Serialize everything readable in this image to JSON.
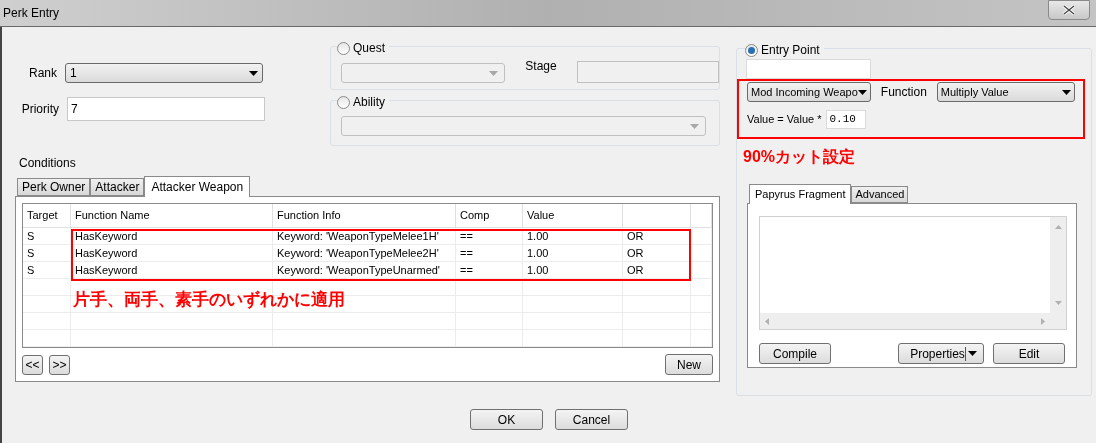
{
  "window": {
    "title": "Perk Entry"
  },
  "rank": {
    "label": "Rank",
    "value": "1"
  },
  "priority": {
    "label": "Priority",
    "value": "7"
  },
  "quest": {
    "label": "Quest",
    "selected": false,
    "stage_label": "Stage"
  },
  "ability": {
    "label": "Ability",
    "selected": false
  },
  "entry_point": {
    "label": "Entry Point",
    "selected": true,
    "entry": "Mod Incoming Weapo",
    "function_label": "Function",
    "function": "Multiply Value",
    "formula_label": "Value = Value *",
    "formula_value": "0.10"
  },
  "conditions": {
    "label": "Conditions",
    "tabs": [
      {
        "label": "Perk Owner",
        "selected": false
      },
      {
        "label": "Attacker",
        "selected": false
      },
      {
        "label": "Attacker Weapon",
        "selected": true
      }
    ],
    "columns": [
      "Target",
      "Function Name",
      "Function Info",
      "Comp",
      "Value"
    ],
    "rows": [
      [
        "S",
        "HasKeyword",
        "Keyword: 'WeaponTypeMelee1H'",
        "==",
        "1.00",
        "OR"
      ],
      [
        "S",
        "HasKeyword",
        "Keyword: 'WeaponTypeMelee2H'",
        "==",
        "1.00",
        "OR"
      ],
      [
        "S",
        "HasKeyword",
        "Keyword: 'WeaponTypeUnarmed'",
        "==",
        "1.00",
        "OR"
      ]
    ],
    "nav_buttons": [
      "<<",
      ">>"
    ],
    "new_button": "New"
  },
  "fragment": {
    "tabs": [
      {
        "label": "Papyrus Fragment",
        "selected": true
      },
      {
        "label": "Advanced",
        "selected": false
      }
    ],
    "compile": "Compile",
    "properties": "Properties",
    "edit": "Edit"
  },
  "annotations": {
    "entry_note": "90%カット設定",
    "conditions_note": "片手、両手、素手のいずれかに適用"
  },
  "buttons": [
    "OK",
    "Cancel"
  ]
}
